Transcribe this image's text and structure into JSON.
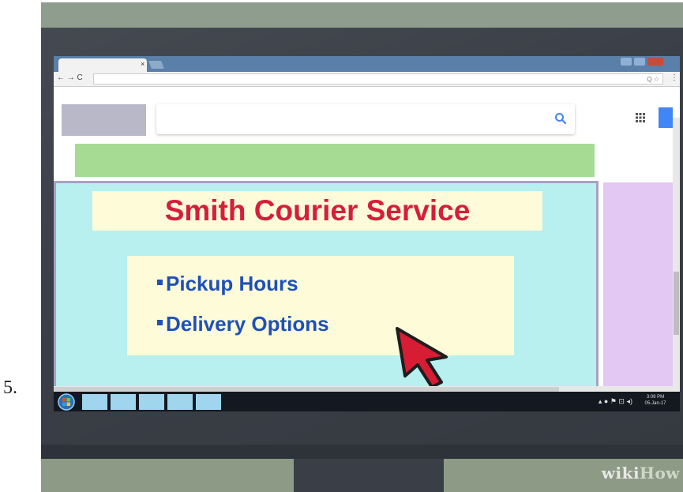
{
  "step_number": "5.",
  "watermark": {
    "wiki": "wiki",
    "how": "How"
  },
  "browser": {
    "tab_close": "×",
    "nav_buttons": "← → C",
    "omnibox_icons": "Q ☆",
    "menu": "⋮"
  },
  "page": {
    "title": "Smith Courier Service",
    "links": [
      "Pickup Hours",
      "Delivery Options"
    ]
  },
  "taskbar": {
    "clock_time": "3:09 PM",
    "clock_date": "05-Jan-17",
    "tiles_count_label": "",
    "tray_text": "▴ ● ⚑ ⊡ ◂)"
  },
  "colors": {
    "title": "#d41f3c",
    "links": "#1f4fb9",
    "content_bg": "#b7f0ee",
    "banner": "#a6db94",
    "sidebar": "#e2c8f3"
  }
}
